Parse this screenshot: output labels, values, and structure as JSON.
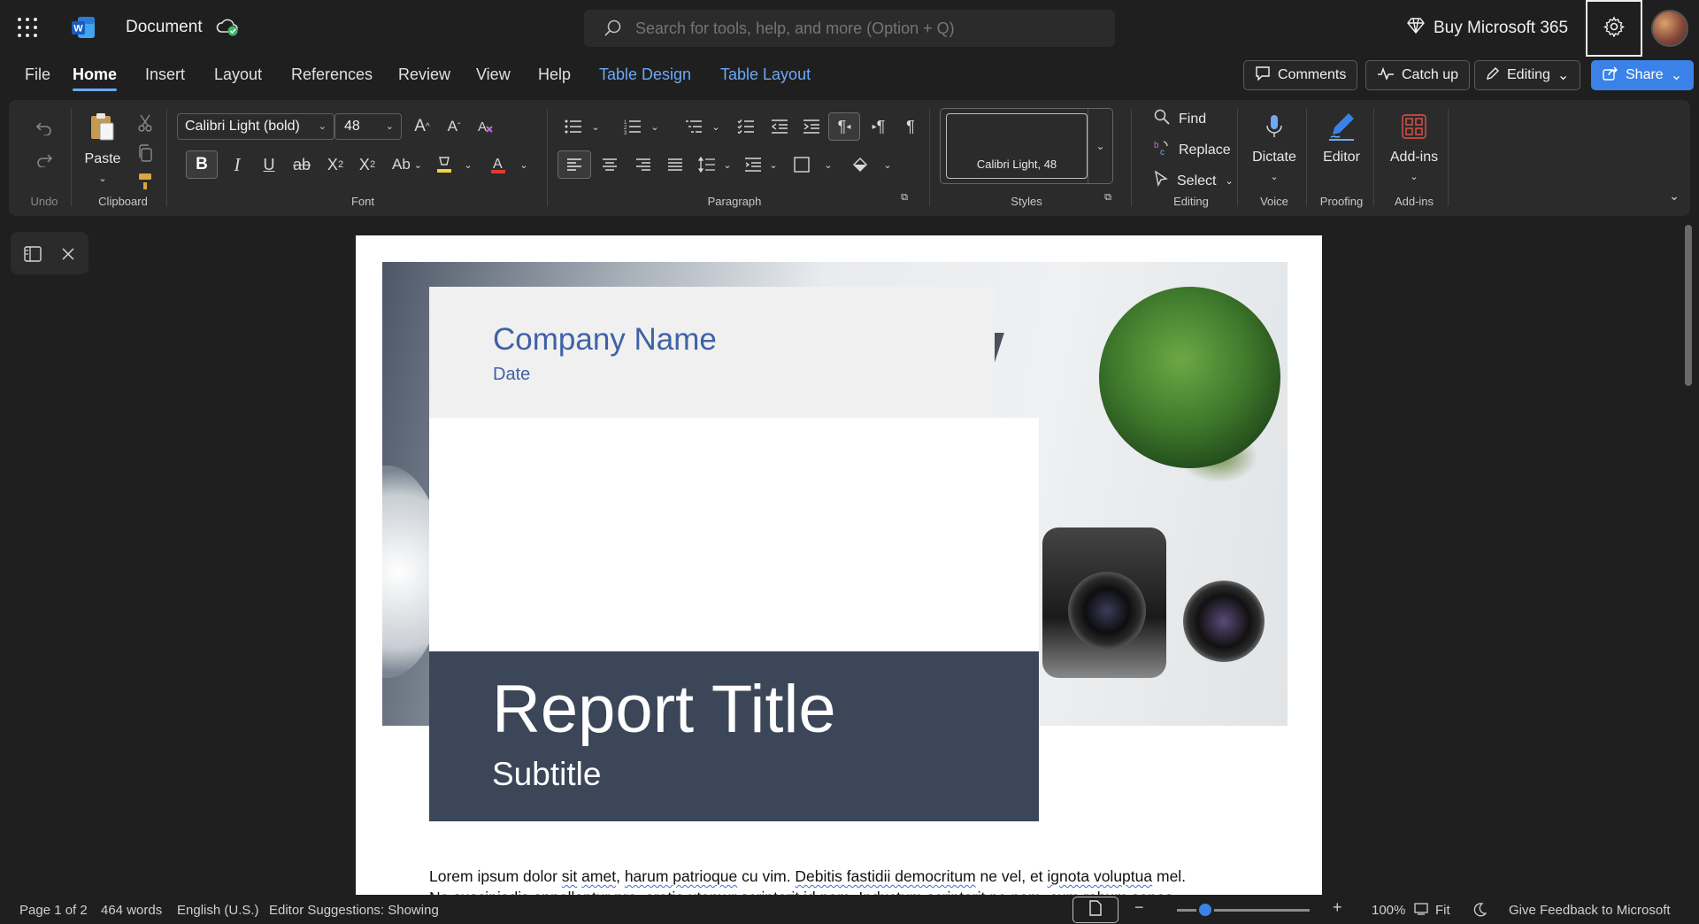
{
  "titlebar": {
    "doc_title": "Document",
    "search_placeholder": "Search for tools, help, and more (Option + Q)",
    "buy_label": "Buy Microsoft 365"
  },
  "tabs": [
    "File",
    "Home",
    "Insert",
    "Layout",
    "References",
    "Review",
    "View",
    "Help",
    "Table Design",
    "Table Layout"
  ],
  "actions": {
    "comments": "Comments",
    "catch_up": "Catch up",
    "editing": "Editing",
    "share": "Share"
  },
  "ribbon": {
    "undo_group": "Undo",
    "clipboard_group": "Clipboard",
    "paste_label": "Paste",
    "font_group": "Font",
    "font_name": "Calibri Light (bold)",
    "font_size": "48",
    "paragraph_group": "Paragraph",
    "styles_group": "Styles",
    "style_preview": "Calibri Light, 48",
    "editing_group": "Editing",
    "find": "Find",
    "replace": "Replace",
    "select": "Select",
    "voice_group": "Voice",
    "dictate": "Dictate",
    "proofing_group": "Proofing",
    "editor": "Editor",
    "addins_group": "Add-ins",
    "addins": "Add-ins"
  },
  "document": {
    "company_name": "Company Name",
    "date": "Date",
    "report_title": "Report Title",
    "subtitle": "Subtitle",
    "body_line1_a": "Lorem ipsum dolor ",
    "body_line1_b": "sit",
    "body_line1_c": " ",
    "body_line1_d": "amet",
    "body_line1_e": ", ",
    "body_line1_f": "harum patrioque",
    "body_line1_g": " cu vim. ",
    "body_line1_h": "Debitis fastidii democritum",
    "body_line1_i": " ne vel, et ",
    "body_line1_j": "ignota voluptua",
    "body_line1_k": " mel.",
    "body_line2": "Ne suscipiadis appellantur pro, oratio utamur scriptorit id nam. Inductum scriptorit ne nam, cum rebum sonos"
  },
  "status": {
    "page": "Page 1 of 2",
    "words": "464 words",
    "language": "English (U.S.)",
    "editor_suggestions": "Editor Suggestions: Showing",
    "zoom": "100%",
    "fit": "Fit",
    "feedback": "Give Feedback to Microsoft"
  }
}
